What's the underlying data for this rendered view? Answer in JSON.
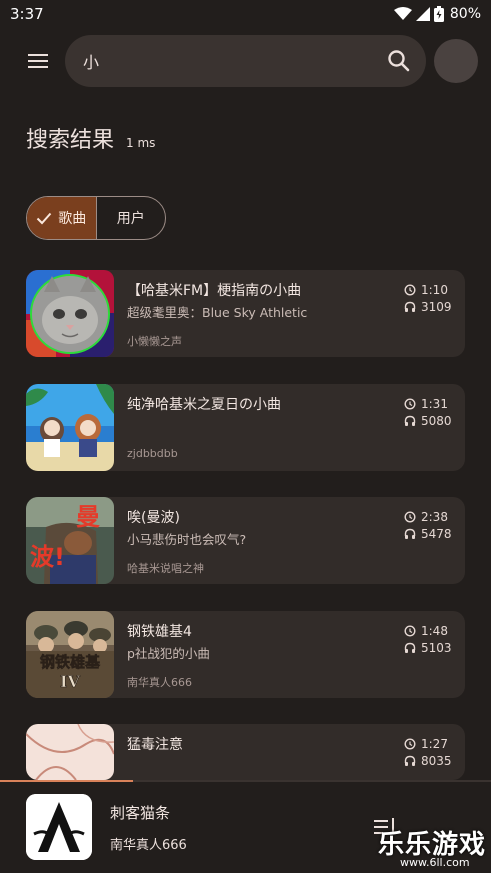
{
  "status_bar": {
    "time": "3:37",
    "battery": "80%"
  },
  "search": {
    "value": "小",
    "placeholder": ""
  },
  "results": {
    "title": "搜索结果",
    "elapsed": "1 ms"
  },
  "tabs": [
    {
      "label": "歌曲",
      "selected": true
    },
    {
      "label": "用户",
      "selected": false
    }
  ],
  "songs": [
    {
      "title": "【哈基米FM】梗指南の小曲",
      "subtitle": "超级耄里奥：Blue Sky Athletic",
      "artist": "小懒懒之声",
      "duration": "1:10",
      "plays": "3109",
      "cover": "cat-cover"
    },
    {
      "title": "纯净哈基米之夏日の小曲",
      "subtitle": "",
      "artist": "zjdbbdbb",
      "duration": "1:31",
      "plays": "5080",
      "cover": "anime-beach-cover"
    },
    {
      "title": "唉(曼波)",
      "subtitle": "小马悲伤时也会叹气?",
      "artist": "哈基米说唱之神",
      "duration": "2:38",
      "plays": "5478",
      "cover": "manbo-cover",
      "cover_text_1": "曼",
      "cover_text_2": "波!"
    },
    {
      "title": "钢铁雄基4",
      "subtitle": "p社战犯的小曲",
      "artist": "南华真人666",
      "duration": "1:48",
      "plays": "5103",
      "cover": "hoi4-cover",
      "cover_text_1": "钢铁雄基",
      "cover_text_2": "IV"
    },
    {
      "title": "猛毒注意",
      "subtitle": "",
      "artist": "",
      "duration": "1:27",
      "plays": "8035",
      "cover": "sketch-cover"
    }
  ],
  "now_playing": {
    "title": "刺客猫条",
    "artist": "南华真人666",
    "progress": 0.27
  },
  "watermark": {
    "text": "乐乐游戏",
    "url": "www.6ll.com"
  },
  "colors": {
    "background": "#221e1c",
    "card": "#322c29",
    "accent": "#7a3f1e",
    "progress": "#d9825a"
  }
}
